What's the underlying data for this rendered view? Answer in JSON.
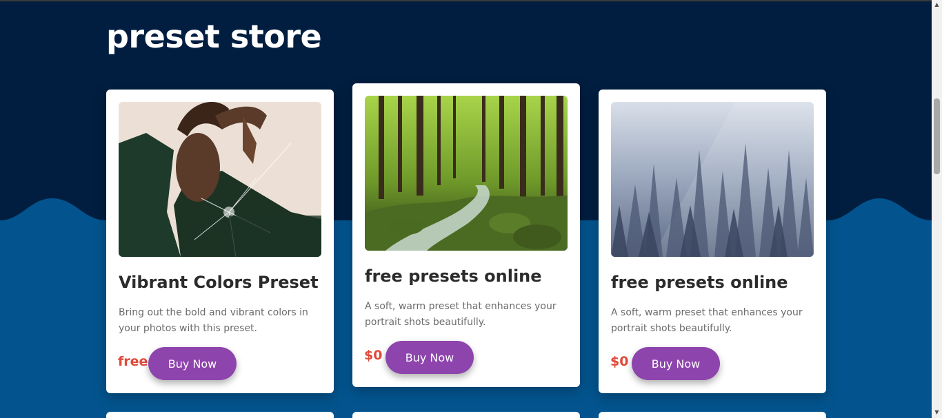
{
  "page": {
    "title": "preset store"
  },
  "colors": {
    "background_dark": "#011e40",
    "background_wave": "#03548e",
    "accent_button": "#8e44ad",
    "price": "#e04a3a"
  },
  "cards": [
    {
      "title": "Vibrant Colors Preset",
      "description": "Bring out the bold and vibrant colors in your photos with this preset.",
      "price": "free",
      "button": "Buy Now",
      "image": "portrait-shattered-glass"
    },
    {
      "title": "free presets online",
      "description": "A soft, warm preset that enhances your portrait shots beautifully.",
      "price": "$0",
      "button": "Buy Now",
      "image": "forest-stream"
    },
    {
      "title": "free presets online",
      "description": "A soft, warm preset that enhances your portrait shots beautifully.",
      "price": "$0",
      "button": "Buy Now",
      "image": "misty-pine-forest"
    }
  ]
}
